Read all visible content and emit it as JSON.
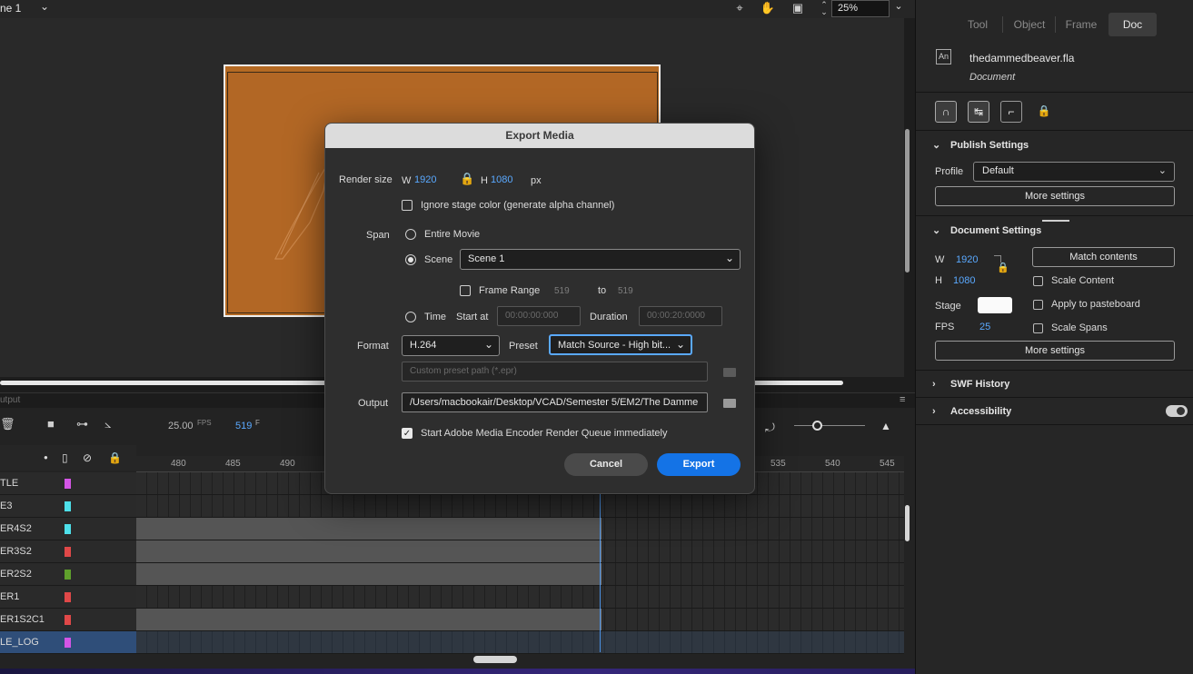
{
  "topbar": {
    "scene": "ne 1",
    "zoom": "25%",
    "icons": [
      "transform-center-icon",
      "hand-icon",
      "clip-icon",
      "stepper-icon"
    ]
  },
  "timeline": {
    "output_tab": "utput",
    "fps": "25.00",
    "fps_unit": "FPS",
    "frame": "519",
    "frame_unit": "F",
    "ruler": [
      "480",
      "485",
      "490",
      "535",
      "540",
      "545"
    ],
    "layers": [
      {
        "name": "TLE",
        "color": "#d455e6",
        "span": false,
        "selected": false
      },
      {
        "name": "E3",
        "color": "#4ee0ea",
        "span": false,
        "selected": false
      },
      {
        "name": "ER4S2",
        "color": "#4ee0ea",
        "span": true,
        "selected": false
      },
      {
        "name": "ER3S2",
        "color": "#e04848",
        "span": true,
        "selected": false
      },
      {
        "name": "ER2S2",
        "color": "#5fa02c",
        "span": true,
        "selected": false
      },
      {
        "name": "ER1",
        "color": "#e04848",
        "span": false,
        "selected": false
      },
      {
        "name": "ER1S2C1",
        "color": "#e04848",
        "span": true,
        "selected": false
      },
      {
        "name": "LE_LOG",
        "color": "#d455e6",
        "span": false,
        "selected": true
      }
    ]
  },
  "panel": {
    "tabs": [
      "Tool",
      "Object",
      "Frame",
      "Doc"
    ],
    "active_tab": "Doc",
    "doc_icon": "An",
    "doc_name": "thedammedbeaver.fla",
    "doc_type": "Document",
    "publish": {
      "title": "Publish Settings",
      "profile_label": "Profile",
      "profile_value": "Default",
      "more": "More settings"
    },
    "document": {
      "title": "Document Settings",
      "w_label": "W",
      "w": "1920",
      "h_label": "H",
      "h": "1080",
      "match": "Match contents",
      "scale_content": "Scale Content",
      "stage_label": "Stage",
      "apply_paste": "Apply to pasteboard",
      "fps_label": "FPS",
      "fps": "25",
      "scale_spans": "Scale Spans",
      "more": "More settings"
    },
    "swf_history": "SWF History",
    "accessibility": "Accessibility"
  },
  "dialog": {
    "title": "Export Media",
    "render_size_label": "Render size",
    "w_label": "W",
    "w": "1920",
    "h_label": "H",
    "h": "1080",
    "unit": "px",
    "ignore_stage": "Ignore stage color (generate alpha channel)",
    "span_label": "Span",
    "entire_movie": "Entire Movie",
    "scene_label": "Scene",
    "scene_value": "Scene 1",
    "frame_range": "Frame Range",
    "range_from": "519",
    "range_to_label": "to",
    "range_to": "519",
    "time_label": "Time",
    "start_at_label": "Start at",
    "start_at": "00:00:00:000",
    "duration_label": "Duration",
    "duration": "00:00:20:0000",
    "format_label": "Format",
    "format_value": "H.264",
    "preset_label": "Preset",
    "preset_value": "Match Source - High bit...",
    "custom_preset_placeholder": "Custom preset path (*.epr)",
    "output_label": "Output",
    "output_path": "/Users/macbookair/Desktop/VCAD/Semester 5/EM2/The Damme",
    "start_encoder": "Start Adobe Media Encoder Render Queue immediately",
    "cancel": "Cancel",
    "export": "Export"
  }
}
